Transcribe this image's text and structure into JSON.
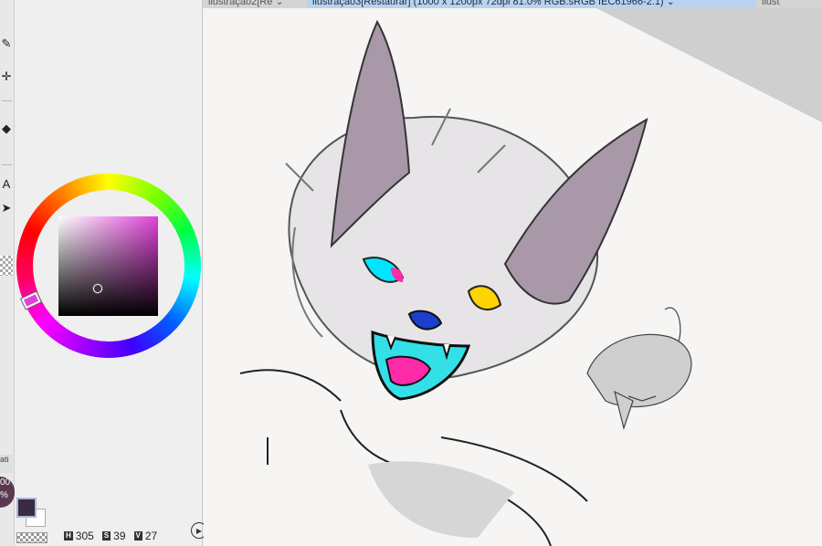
{
  "tabs": [
    {
      "label": "ilustração2[Re",
      "active": false
    },
    {
      "label": "ilustração3[Restaurar]  (1000 x 1200px 72dpi 81.0% RGB:sRGB IEC61966-2.1)",
      "active": true
    },
    {
      "label": "ilust",
      "active": false
    }
  ],
  "toolbar": {
    "icons": [
      "eyedropper-icon",
      "move-icon",
      "fill-bucket-icon",
      "text-icon",
      "arrow-icon",
      "checker-icon"
    ]
  },
  "color_panel": {
    "current_color": "#3a2a44",
    "secondary_color": "#ffffff",
    "hue_color": "#e040d8",
    "hsv": {
      "h_label": "H",
      "h": "305",
      "s_label": "S",
      "s": "39",
      "v_label": "V",
      "v": "27"
    }
  },
  "zoom_badge": "00\n%",
  "side_tab_label": "ati",
  "canvas": {
    "eye_left_color": "#00e5ff",
    "eye_right_color": "#ffd400",
    "mouth_color": "#34e0e8",
    "tongue_color": "#ff2aa8",
    "nose_color": "#1a3fcf",
    "ear_color": "#a898a8"
  }
}
